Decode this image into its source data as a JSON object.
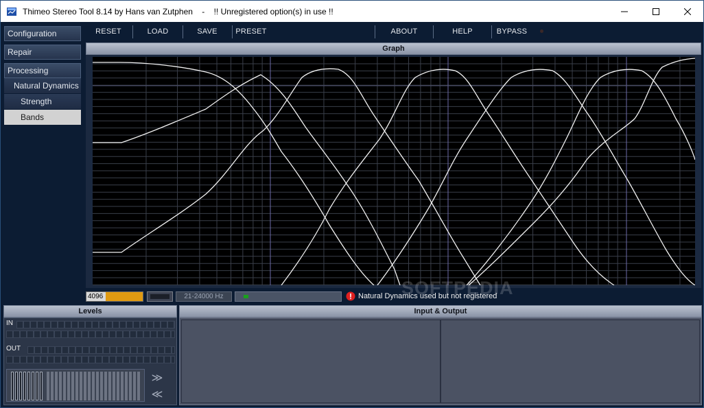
{
  "window": {
    "title": "Thimeo Stereo Tool 8.14 by Hans van Zutphen    -    !! Unregistered option(s) in use !!",
    "controls": [
      "minimize",
      "maximize",
      "close"
    ]
  },
  "sidebar": {
    "items": [
      {
        "label": "Configuration",
        "level": 0
      },
      {
        "label": "Repair",
        "level": 0
      },
      {
        "label": "Processing",
        "level": 0
      },
      {
        "label": "Natural Dynamics",
        "level": 1
      },
      {
        "label": "Strength",
        "level": 2
      },
      {
        "label": "Bands",
        "level": 2,
        "selected": true
      }
    ]
  },
  "toolbar": {
    "reset": "RESET",
    "load": "LOAD",
    "save": "SAVE",
    "preset": "PRESET",
    "about": "ABOUT",
    "help": "HELP",
    "bypass": "BYPASS"
  },
  "graph": {
    "header": "Graph"
  },
  "status": {
    "buffer_size": "4096",
    "frequency_range": "21-24000 Hz",
    "warning": "Natural Dynamics used but not registered"
  },
  "levels": {
    "header": "Levels",
    "in_label": "IN",
    "out_label": "OUT",
    "forward_arrow": "≫",
    "back_arrow": "≪"
  },
  "io": {
    "header": "Input & Output"
  },
  "watermark": "SOFTPEDIA",
  "colors": {
    "background": "#0c1c33",
    "graph_bg": "#000000",
    "buffer_bar": "#e09a12",
    "status_led": "#19a11c",
    "warning": "#e02020"
  }
}
